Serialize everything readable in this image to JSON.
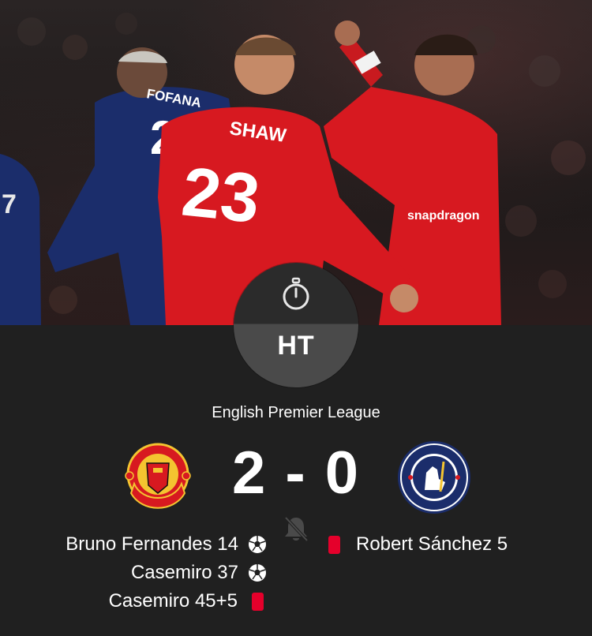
{
  "match": {
    "status": "HT",
    "league": "English Premier League",
    "score": "2 - 0",
    "home_team": {
      "crest_icon": "manchester-united-crest"
    },
    "away_team": {
      "crest_icon": "chelsea-crest"
    }
  },
  "home_events": [
    {
      "text": "Bruno Fernandes 14",
      "icon": "football-icon"
    },
    {
      "text": "Casemiro 37",
      "icon": "football-icon"
    },
    {
      "text": "Casemiro 45+5",
      "icon": "red-card-icon"
    }
  ],
  "away_events": [
    {
      "text": "Robert Sánchez 5",
      "icon": "red-card-icon"
    }
  ],
  "hero": {
    "jersey_name": "SHAW",
    "jersey_number": "23",
    "opponent_name": "FOFANA",
    "opponent_number": "29"
  },
  "colors": {
    "background": "#202020",
    "red_card": "#e5002b",
    "home_kit": "#d71920",
    "away_kit": "#1b2d6b"
  }
}
